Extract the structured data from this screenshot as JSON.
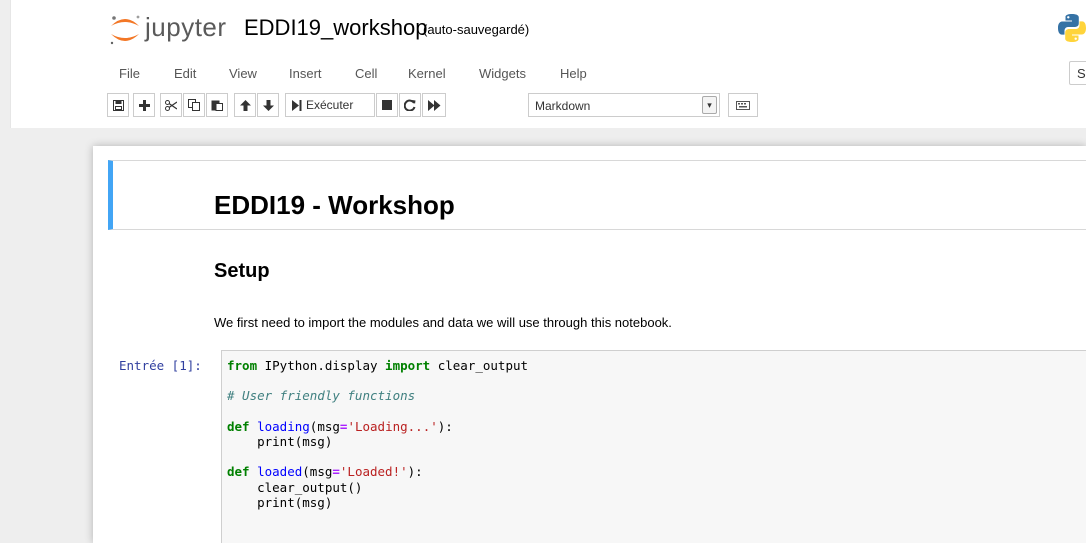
{
  "header": {
    "app_name": "jupyter",
    "notebook_name": "EDDI19_workshop",
    "autosave_status": "(auto-sauvegardé)"
  },
  "menu": {
    "items": [
      "File",
      "Edit",
      "View",
      "Insert",
      "Cell",
      "Kernel",
      "Widgets",
      "Help"
    ],
    "right_label": "Sa"
  },
  "toolbar": {
    "run_label": "Exécuter",
    "cell_type": "Markdown"
  },
  "notebook": {
    "title": "EDDI19 - Workshop",
    "setup_heading": "Setup",
    "intro_text": "We first need to import the modules and data we will use through this notebook.",
    "code_prompt": "Entrée [1]:",
    "code_lines": [
      "from IPython.display import clear_output",
      "",
      "# User friendly functions",
      "",
      "def loading(msg='Loading...'):",
      "    print(msg)",
      "",
      "def loaded(msg='Loaded!'):",
      "    clear_output()",
      "    print(msg)"
    ]
  },
  "colors": {
    "accent_blue": "#42a5f5",
    "jupyter_orange": "#f37726",
    "prompt_blue": "#303f9f"
  },
  "icons": [
    "jupyter-logo-icon",
    "python-logo-icon",
    "save-icon",
    "plus-icon",
    "cut-icon",
    "copy-icon",
    "paste-icon",
    "arrow-up-icon",
    "arrow-down-icon",
    "run-icon",
    "stop-icon",
    "restart-icon",
    "fast-forward-icon",
    "keyboard-icon"
  ]
}
